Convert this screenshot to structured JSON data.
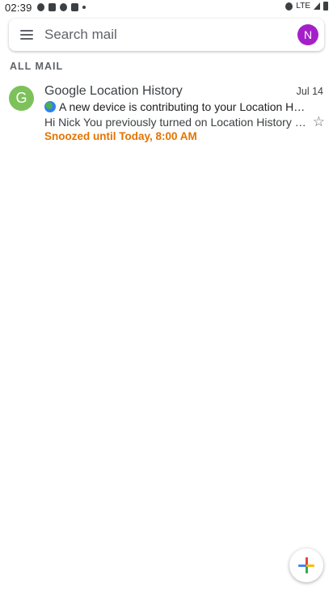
{
  "status_bar": {
    "time": "02:39",
    "network": "LTE"
  },
  "search": {
    "placeholder": "Search mail",
    "account_initial": "N"
  },
  "folder": {
    "label": "ALL MAIL"
  },
  "emails": [
    {
      "sender_initial": "G",
      "sender": "Google Location History",
      "date": "Jul 14",
      "subject": "A new device is contributing to your Location History",
      "snippet": "Hi Nick You previously turned on Location History for your Google Account",
      "snooze_label": "Snoozed until Today, 8:00 AM",
      "starred": false
    }
  ],
  "colors": {
    "avatar_account": "#a51fc9",
    "avatar_sender": "#7cc15a",
    "snooze_text": "#e37400"
  },
  "icons": {
    "menu": "menu-icon",
    "star": "star-outline-icon",
    "compose": "compose-plus-icon"
  }
}
